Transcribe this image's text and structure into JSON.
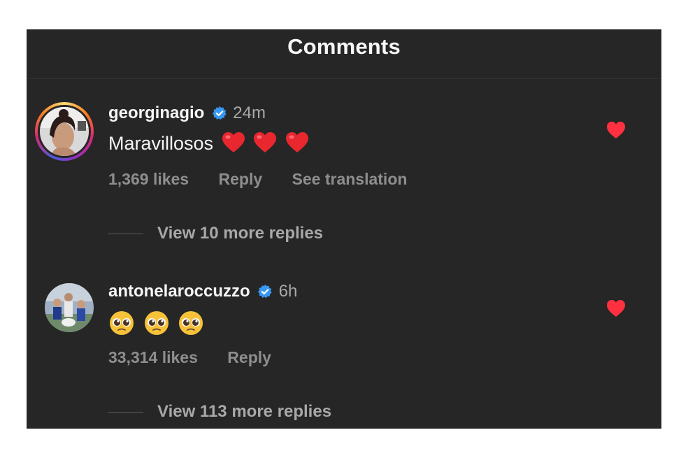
{
  "header": {
    "title": "Comments"
  },
  "comments": [
    {
      "username": "georginagio",
      "verified": true,
      "time": "24m",
      "text": "Maravillosos",
      "emoji": [
        "red-heart",
        "red-heart",
        "red-heart"
      ],
      "likes": "1,369 likes",
      "reply_label": "Reply",
      "translate_label": "See translation",
      "liked": true,
      "view_replies": "View 10 more replies"
    },
    {
      "username": "antonelaroccuzzo",
      "verified": true,
      "time": "6h",
      "text": "",
      "emoji": [
        "pleading-face",
        "pleading-face",
        "pleading-face"
      ],
      "likes": "33,314 likes",
      "reply_label": "Reply",
      "liked": true,
      "view_replies": "View 113 more replies"
    }
  ],
  "colors": {
    "background": "#262626",
    "like_heart": "#ff3040",
    "verified_badge": "#3897f0",
    "secondary_text": "#8e8e8e"
  }
}
